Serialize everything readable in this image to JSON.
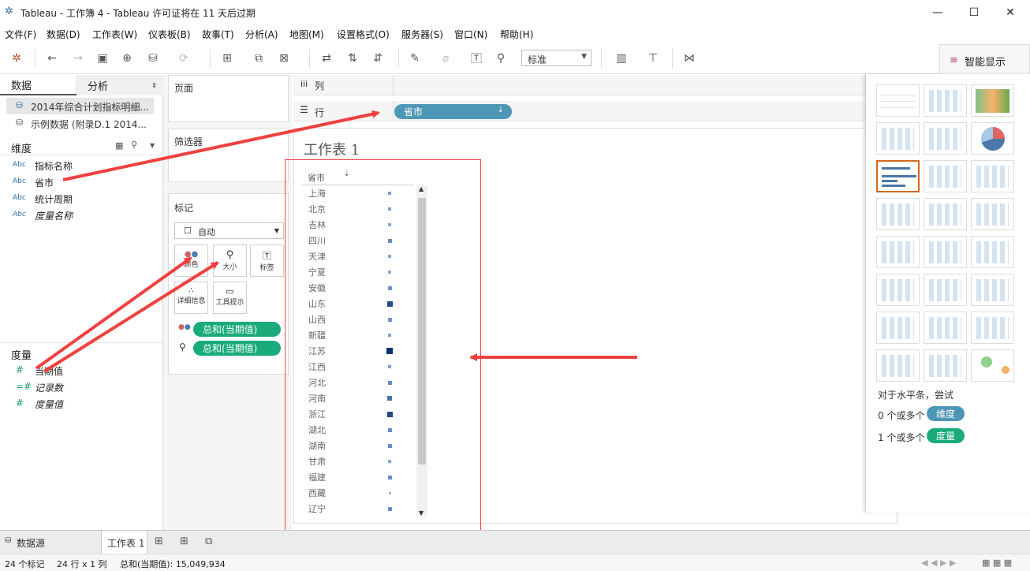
{
  "window": {
    "title": "Tableau - 工作簿 4 - Tableau 许可证将在 11 天后过期",
    "minimize": "—",
    "maximize": "☐",
    "close": "✕"
  },
  "menu": [
    "文件(F)",
    "数据(D)",
    "工作表(W)",
    "仪表板(B)",
    "故事(T)",
    "分析(A)",
    "地图(M)",
    "设置格式(O)",
    "服务器(S)",
    "窗口(N)",
    "帮助(H)"
  ],
  "toolbar": {
    "fit_select": "标准",
    "smart_show": "智能显示"
  },
  "left": {
    "tab_data": "数据",
    "tab_analysis": "分析",
    "datasources": [
      "2014年综合计划指标明细...",
      "示例数据 (附录D.1 2014..."
    ],
    "dimensions_header": "维度",
    "dimensions": [
      "指标名称",
      "省市",
      "统计周期",
      "度量名称"
    ],
    "measures_header": "度量",
    "measures": [
      "当期值",
      "记录数",
      "度量值"
    ],
    "abc": "Abc"
  },
  "cards": {
    "pages": "页面",
    "filters": "筛选器",
    "marks": "标记",
    "mark_type": "自动",
    "buttons": [
      "颜色",
      "大小",
      "标签",
      "详细信息",
      "工具提示"
    ],
    "pills": [
      "总和(当期值)",
      "总和(当期值)"
    ]
  },
  "shelves": {
    "columns": "列",
    "rows": "行",
    "row_pill": "省市"
  },
  "sheet": {
    "title": "工作表 1",
    "header": "省市",
    "rows": [
      {
        "name": "上海",
        "size": 0.25
      },
      {
        "name": "北京",
        "size": 0.2
      },
      {
        "name": "吉林",
        "size": 0.15
      },
      {
        "name": "四川",
        "size": 0.35
      },
      {
        "name": "天津",
        "size": 0.18
      },
      {
        "name": "宁夏",
        "size": 0.12
      },
      {
        "name": "安徽",
        "size": 0.3
      },
      {
        "name": "山东",
        "size": 0.8
      },
      {
        "name": "山西",
        "size": 0.3
      },
      {
        "name": "新疆",
        "size": 0.2
      },
      {
        "name": "江苏",
        "size": 1.0
      },
      {
        "name": "江西",
        "size": 0.22
      },
      {
        "name": "河北",
        "size": 0.35
      },
      {
        "name": "河南",
        "size": 0.55
      },
      {
        "name": "浙江",
        "size": 0.85
      },
      {
        "name": "湖北",
        "size": 0.35
      },
      {
        "name": "湖南",
        "size": 0.35
      },
      {
        "name": "甘肃",
        "size": 0.15
      },
      {
        "name": "福建",
        "size": 0.35
      },
      {
        "name": "西藏",
        "size": 0.05
      },
      {
        "name": "辽宁",
        "size": 0.35
      }
    ]
  },
  "smart": {
    "hint": "对于水平条，尝试",
    "dim_req": "0 个或多个",
    "dim_pill": "维度",
    "mea_req": "1 个或多个",
    "mea_pill": "度量"
  },
  "bottom": {
    "datasource_tab": "数据源",
    "sheet_tab": "工作表 1"
  },
  "status": {
    "marks": "24 个标记",
    "rows_cols": "24 行 x 1 列",
    "sum": "总和(当期值): 15,049,934"
  },
  "colors": {
    "blue_pill": "#4e96b6",
    "green_pill": "#1aab7c",
    "arrow": "#f04040",
    "mark": "#4a78a8"
  }
}
